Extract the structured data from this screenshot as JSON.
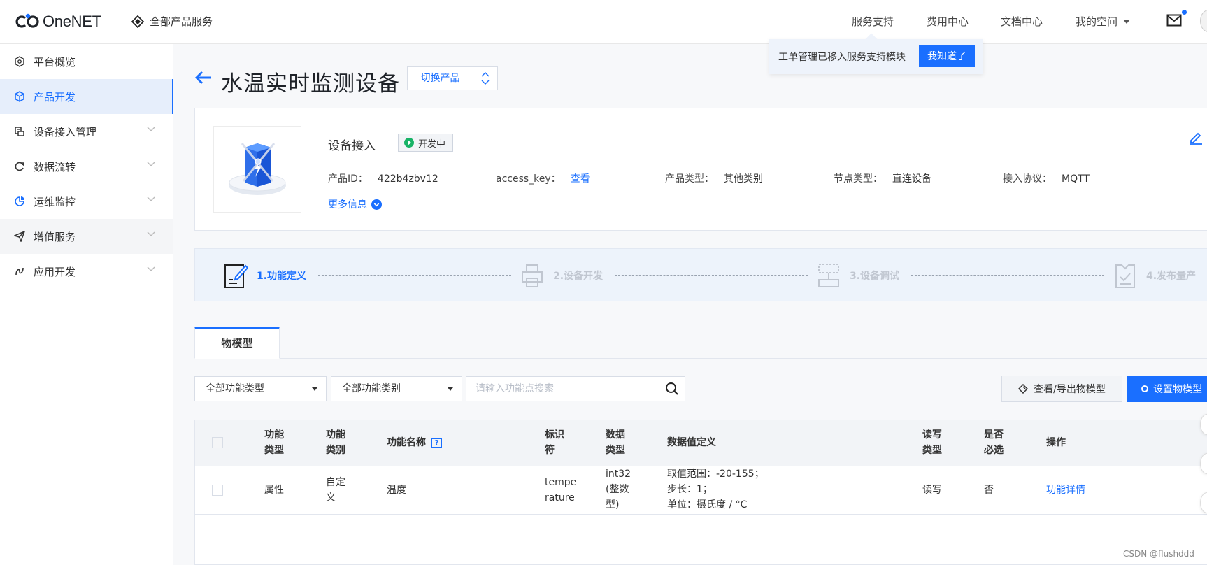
{
  "header": {
    "logo_text": "OneNET",
    "all_products": "全部产品服务",
    "nav": [
      "服务支持",
      "费用中心",
      "文档中心",
      "我的空间"
    ]
  },
  "tooltip": {
    "text": "工单管理已移入服务支持模块",
    "button": "我知道了"
  },
  "sidebar": {
    "items": [
      {
        "label": "平台概览"
      },
      {
        "label": "产品开发"
      },
      {
        "label": "设备接入管理"
      },
      {
        "label": "数据流转"
      },
      {
        "label": "运维监控"
      },
      {
        "label": "增值服务"
      },
      {
        "label": "应用开发"
      }
    ]
  },
  "page": {
    "title": "水温实时监测设备",
    "switch_product": "切换产品"
  },
  "product": {
    "section_title": "设备接入",
    "status": "开发中",
    "product_id_label": "产品ID：",
    "product_id": "422b4zbv12",
    "access_key_label": "access_key：",
    "access_key_link": "查看",
    "type_label": "产品类型：",
    "type": "其他类别",
    "node_label": "节点类型：",
    "node": "直连设备",
    "protocol_label": "接入协议：",
    "protocol": "MQTT",
    "more_info": "更多信息"
  },
  "steps": [
    "1.功能定义",
    "2.设备开发",
    "3.设备调试",
    "4.发布量产"
  ],
  "tabs": [
    "物模型"
  ],
  "filters": {
    "function_type": "全部功能类型",
    "function_category": "全部功能类别",
    "search_placeholder": "请输入功能点搜索",
    "export_button": "查看/导出物模型",
    "set_button": "设置物模型"
  },
  "table": {
    "headers": {
      "func_type": [
        "功能",
        "类型"
      ],
      "func_category": [
        "功能",
        "类别"
      ],
      "func_name": "功能名称",
      "identifier": [
        "标识",
        "符"
      ],
      "data_type": [
        "数据",
        "类型"
      ],
      "value_def": "数据值定义",
      "rw": [
        "读写",
        "类型"
      ],
      "required": [
        "是否",
        "必选"
      ],
      "action": "操作"
    },
    "rows": [
      {
        "func_type": "属性",
        "func_category": [
          "自定",
          "义"
        ],
        "func_name": "温度",
        "identifier": [
          "tempe",
          "rature"
        ],
        "data_type": [
          "int32",
          "(整数",
          "型)"
        ],
        "value_def": [
          "取值范围：-20-155；",
          "步长：1；",
          "单位：摄氏度 / °C"
        ],
        "rw": "读写",
        "required": "否",
        "action": "功能详情"
      }
    ]
  },
  "watermark": "CSDN @flushddd",
  "colors": {
    "accent": "#1a6fff",
    "status_green": "#18b366",
    "steps_bg": "#edf3fb"
  }
}
